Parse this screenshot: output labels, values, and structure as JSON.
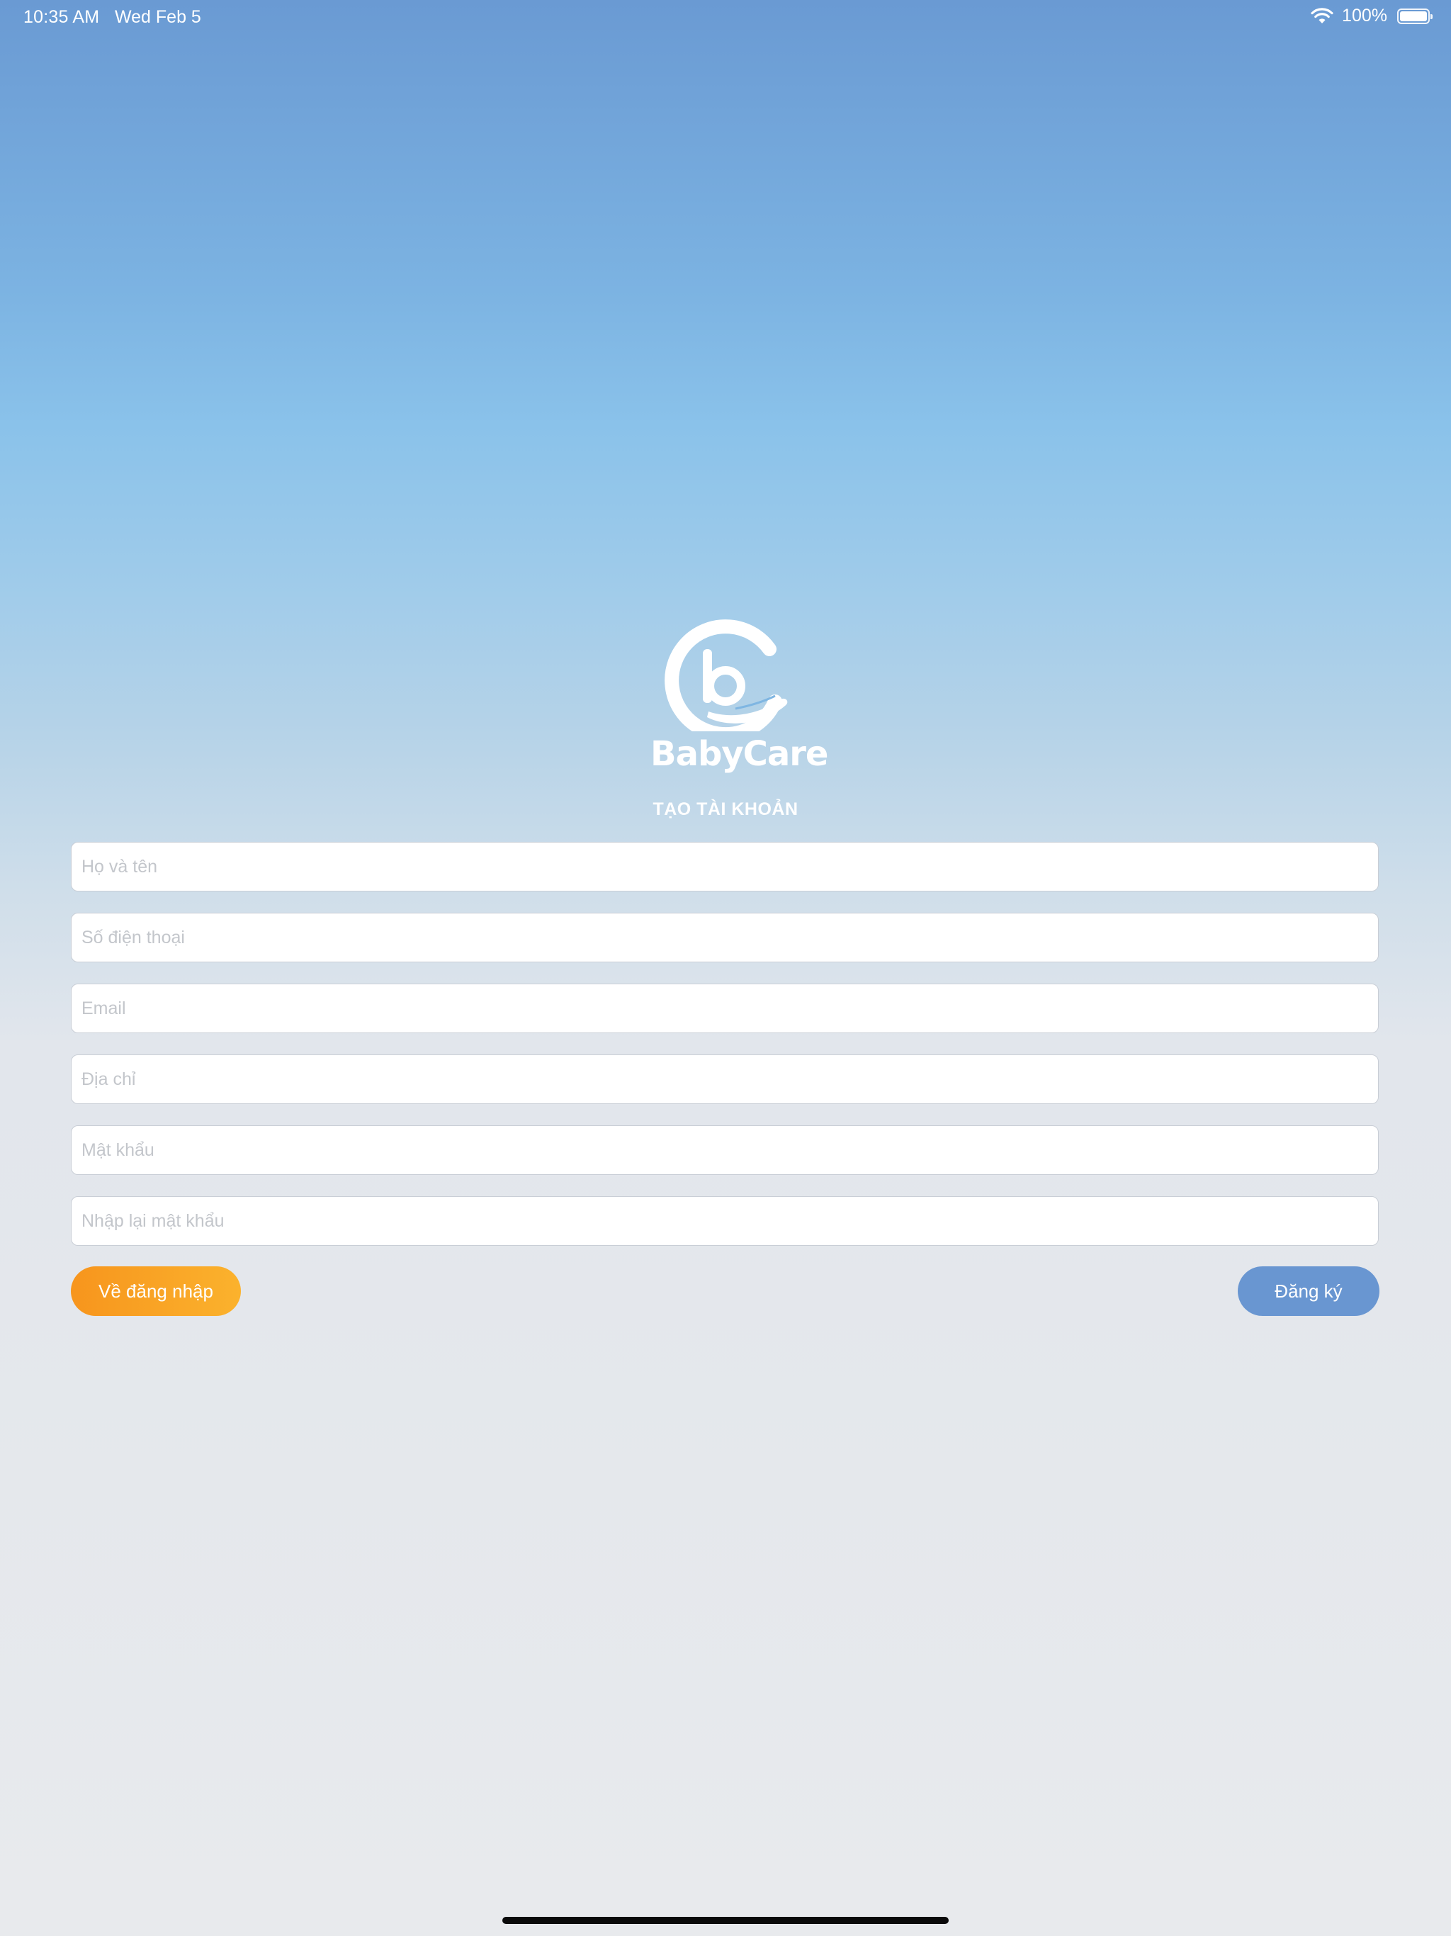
{
  "status_bar": {
    "time": "10:35 AM",
    "date": "Wed Feb 5",
    "battery_percent": "100%",
    "battery_level": 1.0,
    "wifi_icon": "wifi-icon",
    "battery_icon": "battery-icon"
  },
  "logo": {
    "icon": "babycare-logo-icon",
    "brand_name": "BabyCare"
  },
  "form": {
    "title": "TẠO TÀI KHOẢN",
    "fields": {
      "full_name": {
        "placeholder": "Họ và tên",
        "value": ""
      },
      "phone": {
        "placeholder": "Số điện thoại",
        "value": ""
      },
      "email": {
        "placeholder": "Email",
        "value": ""
      },
      "address": {
        "placeholder": "Địa chỉ",
        "value": ""
      },
      "password": {
        "placeholder": "Mật khẩu",
        "value": ""
      },
      "confirm_password": {
        "placeholder": "Nhập lại mật khẩu",
        "value": ""
      }
    },
    "back_to_login_label": "Về đăng nhập",
    "register_label": "Đăng ký"
  },
  "colors": {
    "gradient_top": "#6a9ad3",
    "gradient_bottom": "#e8eaed",
    "back_button": "#f9a324",
    "register_button": "#6996d1"
  }
}
